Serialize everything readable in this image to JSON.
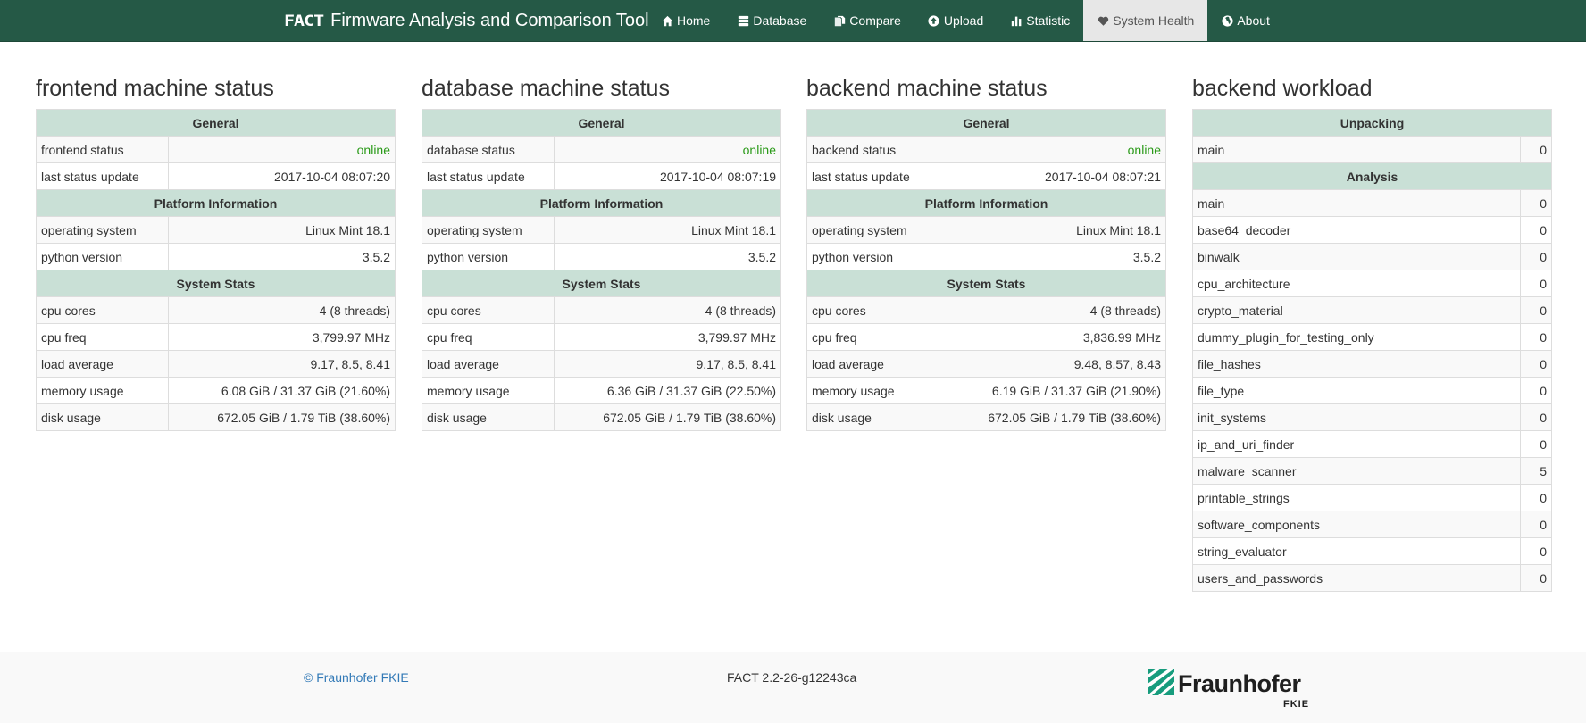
{
  "navbar": {
    "logo_text": "FACT",
    "title": "Firmware Analysis and Comparison Tool",
    "items": [
      {
        "label": "Home",
        "icon": "home-icon"
      },
      {
        "label": "Database",
        "icon": "database-icon"
      },
      {
        "label": "Compare",
        "icon": "copy-icon"
      },
      {
        "label": "Upload",
        "icon": "upload-icon"
      },
      {
        "label": "Statistic",
        "icon": "bar-chart-icon"
      },
      {
        "label": "System Health",
        "icon": "heart-icon",
        "active": true
      },
      {
        "label": "About",
        "icon": "globe-icon"
      }
    ],
    "colors": {
      "background": "#255946",
      "active_background": "#e7e7e7"
    }
  },
  "frontend": {
    "title": "frontend machine status",
    "general": "General",
    "status_label": "frontend status",
    "status_value": "online",
    "update_label": "last status update",
    "update_value": "2017-10-04 08:07:20",
    "platform": "Platform Information",
    "os_label": "operating system",
    "os_value": "Linux Mint 18.1",
    "py_label": "python version",
    "py_value": "3.5.2",
    "stats": "System Stats",
    "cores_label": "cpu cores",
    "cores_value": "4 (8 threads)",
    "freq_label": "cpu freq",
    "freq_value": "3,799.97 MHz",
    "load_label": "load average",
    "load_value": "9.17, 8.5, 8.41",
    "mem_label": "memory usage",
    "mem_value": "6.08 GiB / 31.37 GiB (21.60%)",
    "disk_label": "disk usage",
    "disk_value": "672.05 GiB / 1.79 TiB (38.60%)"
  },
  "database": {
    "title": "database machine status",
    "general": "General",
    "status_label": "database status",
    "status_value": "online",
    "update_label": "last status update",
    "update_value": "2017-10-04 08:07:19",
    "platform": "Platform Information",
    "os_label": "operating system",
    "os_value": "Linux Mint 18.1",
    "py_label": "python version",
    "py_value": "3.5.2",
    "stats": "System Stats",
    "cores_label": "cpu cores",
    "cores_value": "4 (8 threads)",
    "freq_label": "cpu freq",
    "freq_value": "3,799.97 MHz",
    "load_label": "load average",
    "load_value": "9.17, 8.5, 8.41",
    "mem_label": "memory usage",
    "mem_value": "6.36 GiB / 31.37 GiB (22.50%)",
    "disk_label": "disk usage",
    "disk_value": "672.05 GiB / 1.79 TiB (38.60%)"
  },
  "backend": {
    "title": "backend machine status",
    "general": "General",
    "status_label": "backend status",
    "status_value": "online",
    "update_label": "last status update",
    "update_value": "2017-10-04 08:07:21",
    "platform": "Platform Information",
    "os_label": "operating system",
    "os_value": "Linux Mint 18.1",
    "py_label": "python version",
    "py_value": "3.5.2",
    "stats": "System Stats",
    "cores_label": "cpu cores",
    "cores_value": "4 (8 threads)",
    "freq_label": "cpu freq",
    "freq_value": "3,836.99 MHz",
    "load_label": "load average",
    "load_value": "9.48, 8.57, 8.43",
    "mem_label": "memory usage",
    "mem_value": "6.19 GiB / 31.37 GiB (21.90%)",
    "disk_label": "disk usage",
    "disk_value": "672.05 GiB / 1.79 TiB (38.60%)"
  },
  "workload": {
    "title": "backend workload",
    "unpacking": "Unpacking",
    "unpacking_rows": [
      {
        "name": "main",
        "value": "0"
      }
    ],
    "analysis": "Analysis",
    "analysis_rows": [
      {
        "name": "main",
        "value": "0"
      },
      {
        "name": "base64_decoder",
        "value": "0"
      },
      {
        "name": "binwalk",
        "value": "0"
      },
      {
        "name": "cpu_architecture",
        "value": "0"
      },
      {
        "name": "crypto_material",
        "value": "0"
      },
      {
        "name": "dummy_plugin_for_testing_only",
        "value": "0"
      },
      {
        "name": "file_hashes",
        "value": "0"
      },
      {
        "name": "file_type",
        "value": "0"
      },
      {
        "name": "init_systems",
        "value": "0"
      },
      {
        "name": "ip_and_uri_finder",
        "value": "0"
      },
      {
        "name": "malware_scanner",
        "value": "5"
      },
      {
        "name": "printable_strings",
        "value": "0"
      },
      {
        "name": "software_components",
        "value": "0"
      },
      {
        "name": "string_evaluator",
        "value": "0"
      },
      {
        "name": "users_and_passwords",
        "value": "0"
      }
    ]
  },
  "footer": {
    "copyright": "© Fraunhofer FKIE",
    "version": "FACT 2.2-26-g12243ca",
    "logo_name": "Fraunhofer",
    "logo_sub": "FKIE"
  },
  "colors": {
    "table_header": "#c9e0d6",
    "online": "#2a9a18",
    "link": "#337ab7"
  }
}
